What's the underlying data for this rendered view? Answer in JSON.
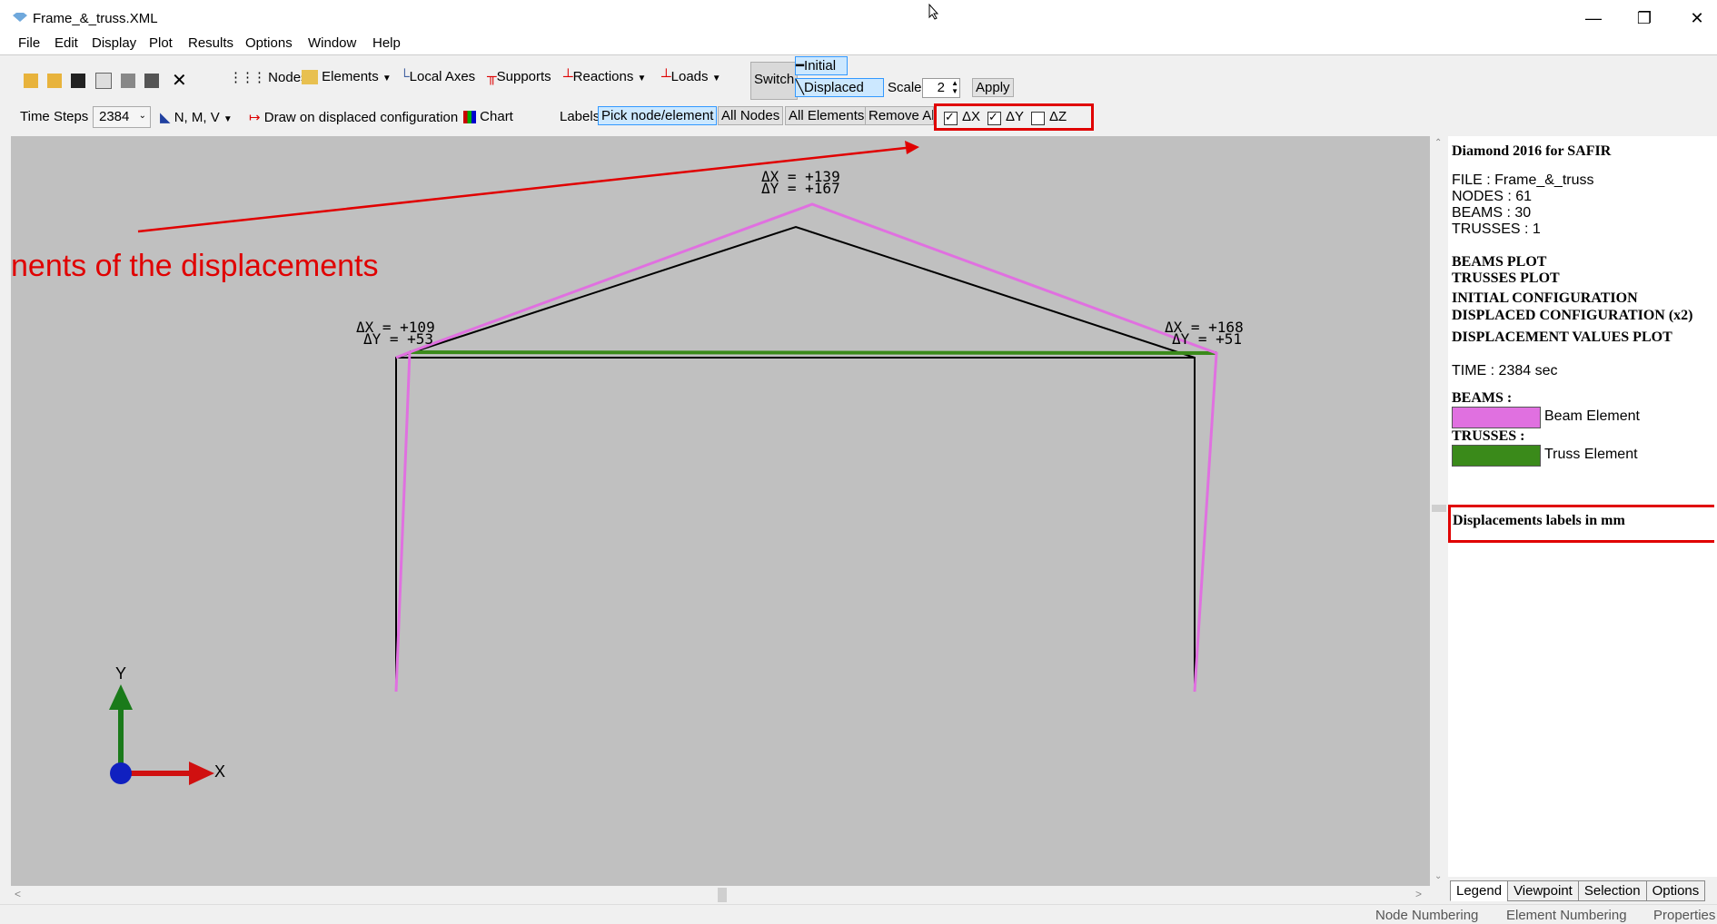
{
  "window": {
    "title": "Frame_&_truss.XML",
    "minimize": "—",
    "restore": "❐",
    "close": "✕"
  },
  "menu": [
    "File",
    "Edit",
    "Display",
    "Plot",
    "Results",
    "Options",
    "Window",
    "Help"
  ],
  "toolbar1": {
    "nodes": "Nodes",
    "elements": "Elements",
    "local_axes": "Local Axes",
    "supports": "Supports",
    "reactions": "Reactions",
    "loads": "Loads",
    "switch": "Switch",
    "initial": "Initial",
    "displaced": "Displaced",
    "scale_label": "Scale",
    "scale_value": "2",
    "apply": "Apply"
  },
  "toolbar2": {
    "time_steps_label": "Time Steps",
    "time_steps_value": "2384",
    "nmv": "N, M, V",
    "draw_displaced": "Draw on displaced configuration",
    "chart": "Chart",
    "labels": "Labels",
    "pick": "Pick node/element",
    "all_nodes": "All Nodes",
    "all_elements": "All Elements",
    "remove_all": "Remove All",
    "dx": "ΔX",
    "dy": "ΔY",
    "dz": "ΔZ"
  },
  "checkboxes": {
    "dx": true,
    "dy": true,
    "dz": false
  },
  "canvas": {
    "annotation": "nents of the displacements",
    "labels": [
      {
        "dx": "ΔX = +139",
        "dy": "ΔY = +167"
      },
      {
        "dx": "ΔX = +109",
        "dy": "ΔY = +53"
      },
      {
        "dx": "ΔX = +168",
        "dy": "ΔY = +51"
      }
    ],
    "axis_y": "Y",
    "axis_x": "X"
  },
  "panel": {
    "heading": "Diamond 2016 for SAFIR",
    "file": "FILE : Frame_&_truss",
    "nodes": "NODES : 61",
    "beams": "BEAMS : 30",
    "trusses": "TRUSSES : 1",
    "beams_plot": "BEAMS PLOT",
    "trusses_plot": "TRUSSES PLOT",
    "initial_config": "INITIAL CONFIGURATION",
    "displaced_config": "DISPLACED CONFIGURATION (x2)",
    "disp_values": "DISPLACEMENT VALUES PLOT",
    "time": "TIME : 2384 sec",
    "beams_header": "BEAMS :",
    "beam_element": "Beam Element",
    "trusses_header": "TRUSSES :",
    "truss_element": "Truss Element",
    "disp_labels": "Displacements labels in mm"
  },
  "panel_tabs": [
    "Legend",
    "Viewpoint",
    "Selection",
    "Options"
  ],
  "status": [
    "Node Numbering",
    "Element Numbering",
    "Properties"
  ],
  "colors": {
    "beam": "#e070e0",
    "truss": "#3a8a1a",
    "annotation": "#e00000"
  }
}
